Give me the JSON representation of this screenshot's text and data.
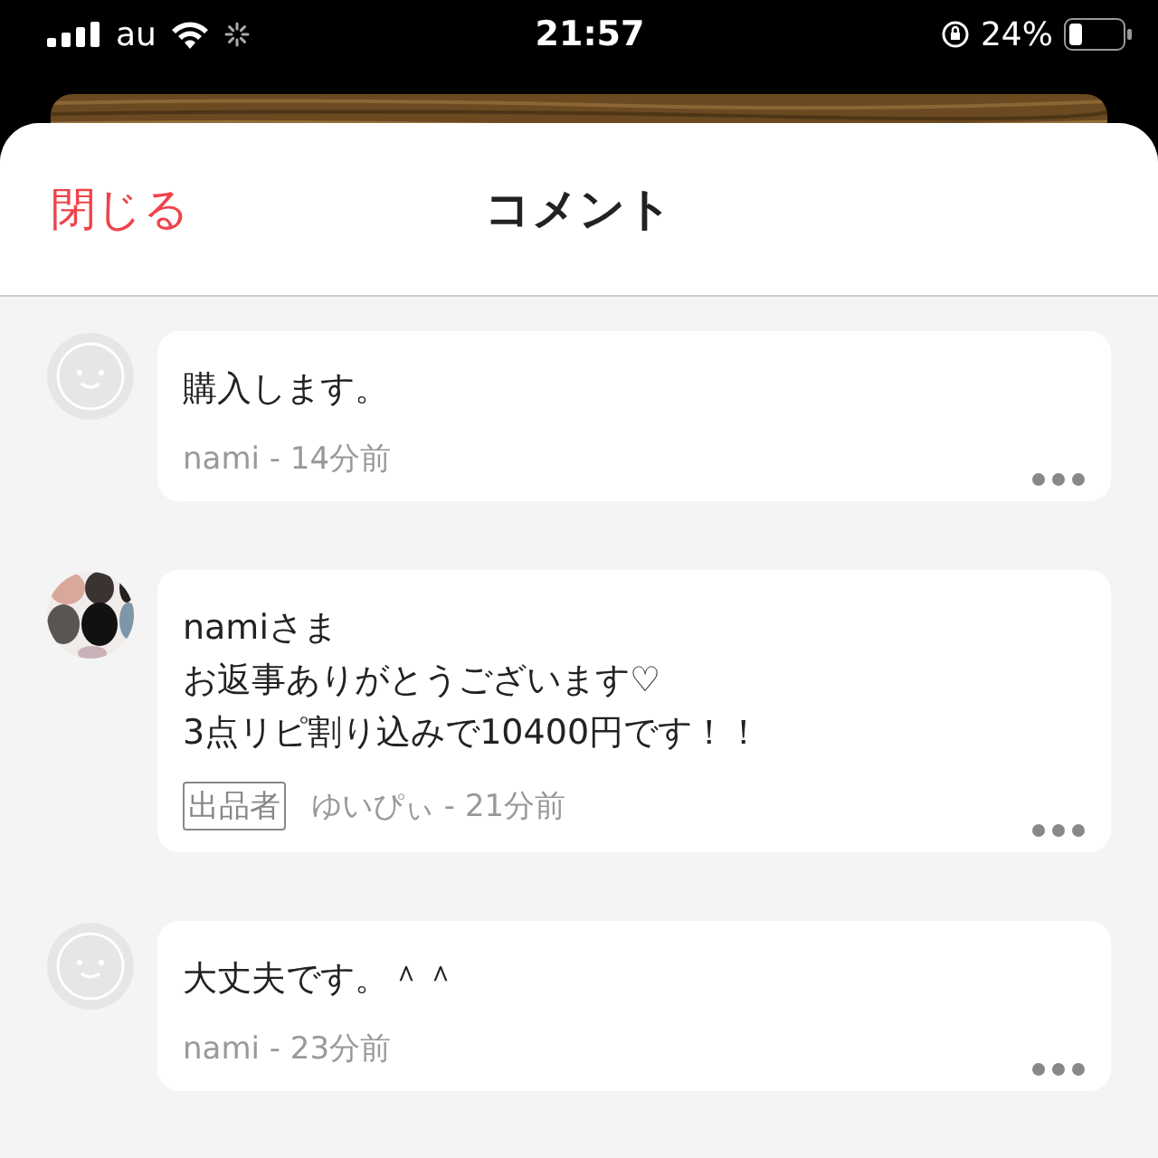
{
  "status_bar": {
    "carrier": "au",
    "time": "21:57",
    "battery": "24%"
  },
  "header": {
    "close": "閉じる",
    "title": "コメント"
  },
  "comments": [
    {
      "avatar": {
        "kind": "default"
      },
      "lines": [
        "購入します。"
      ],
      "meta": "nami - 14分前"
    },
    {
      "lines": [
        "namiさま",
        "お返事ありがとうございます♡",
        "3点リピ割り込みで10400円です！！"
      ],
      "badge": "出品者",
      "meta": "ゆいぴぃ - 21分前"
    },
    {
      "avatar": {
        "kind": "default"
      },
      "lines": [
        "大丈夫です。＾＾"
      ],
      "meta": "nami - 23分前"
    }
  ]
}
